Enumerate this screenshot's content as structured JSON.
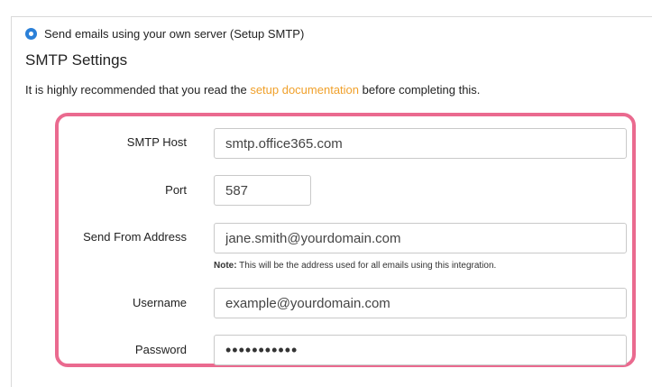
{
  "radio": {
    "label": "Send emails using your own server (Setup SMTP)",
    "selected": true,
    "color": "#2b80d8"
  },
  "section": {
    "title": "SMTP Settings",
    "intro_before": "It is highly recommended that you read the ",
    "intro_link": "setup documentation",
    "intro_after": " before completing this.",
    "link_color": "#f0a02a"
  },
  "highlight_color": "#ea6a8f",
  "form": {
    "host": {
      "label": "SMTP Host",
      "value": "smtp.office365.com"
    },
    "port": {
      "label": "Port",
      "value": "587"
    },
    "from": {
      "label": "Send From Address",
      "value": "jane.smith@yourdomain.com",
      "note_bold": "Note:",
      "note_text": " This will be the address used for all emails using this integration."
    },
    "username": {
      "label": "Username",
      "value": "example@yourdomain.com"
    },
    "password": {
      "label": "Password",
      "value": "•••••••••••"
    }
  }
}
